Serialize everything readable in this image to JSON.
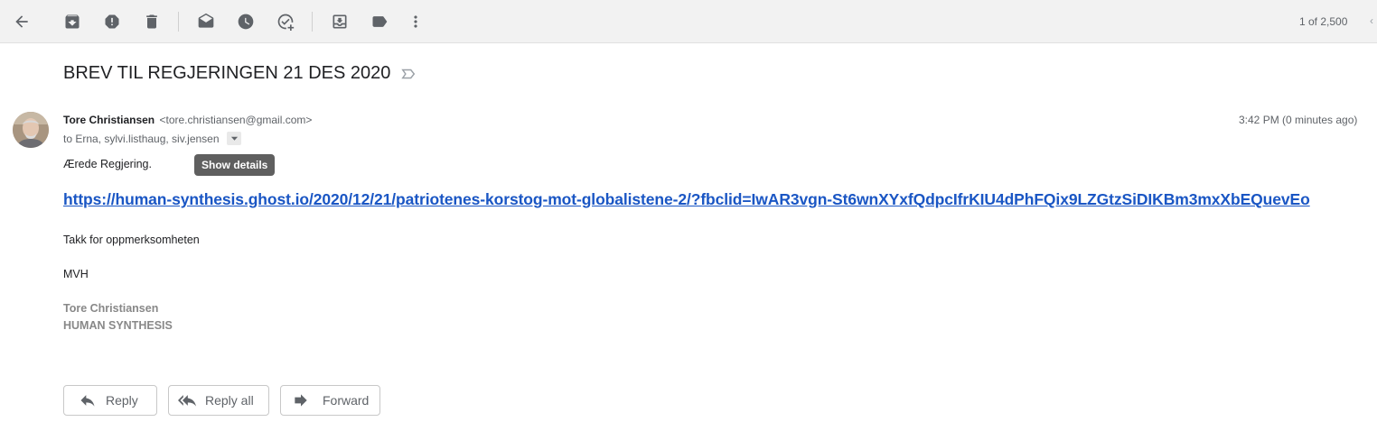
{
  "toolbar": {
    "icons": [
      "back-arrow-icon",
      "archive-icon",
      "report-spam-icon",
      "delete-icon",
      "mark-unread-icon",
      "snooze-icon",
      "add-to-tasks-icon",
      "move-to-icon",
      "labels-icon",
      "more-icon"
    ],
    "pager_text": "1 of 2,500"
  },
  "email": {
    "subject": "BREV TIL REGJERINGEN 21 DES 2020",
    "sender_name": "Tore Christiansen",
    "sender_email": "<tore.christiansen@gmail.com>",
    "recipients": "to Erna, sylvi.listhaug, siv.jensen",
    "timestamp": "3:42 PM (0 minutes ago)",
    "tooltip": "Show details",
    "greeting": "Ærede Regjering.",
    "link": "https://human-synthesis.ghost.io/2020/12/21/patriotenes-korstog-mot-globalistene-2/?fbclid=IwAR3vgn-St6wnXYxfQdpcIfrKIU4dPhFQix9LZGtzSiDIKBm3mxXbEQuevEo",
    "thanks": "Takk for oppmerksomheten",
    "closing": "MVH",
    "signature_name": "Tore Christiansen",
    "signature_org": "HUMAN SYNTHESIS"
  },
  "actions": {
    "reply": "Reply",
    "reply_all": "Reply all",
    "forward": "Forward"
  },
  "colors": {
    "link": "#1a56c4",
    "toolbar_bg": "#f2f2f2",
    "icon": "#5f6368"
  }
}
